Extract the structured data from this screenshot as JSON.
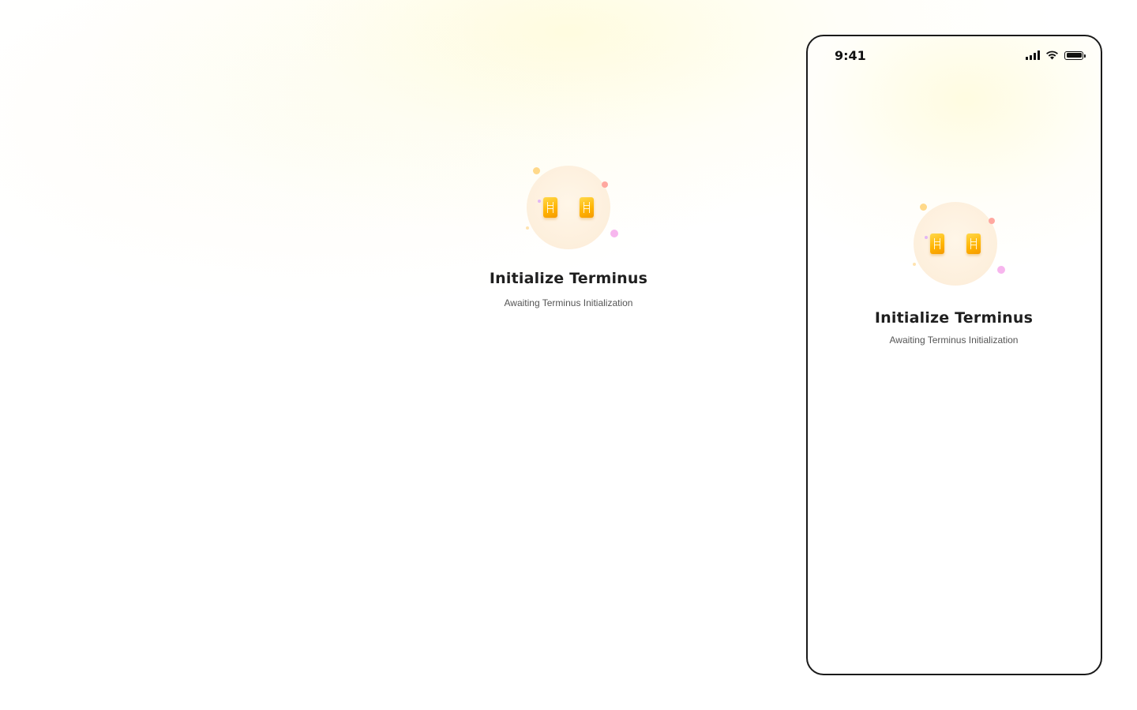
{
  "desktop": {
    "title": "Initialize Terminus",
    "subtitle": "Awaiting Terminus Initialization",
    "illustration_icon": "terminus-cards-icon"
  },
  "mobile": {
    "status_bar": {
      "time": "9:41",
      "icons": [
        "cellular-signal-icon",
        "wifi-icon",
        "battery-icon"
      ]
    },
    "title": "Initialize Terminus",
    "subtitle": "Awaiting Terminus Initialization",
    "illustration_icon": "terminus-cards-icon"
  },
  "colors": {
    "title": "#1f1f1f",
    "subtitle": "#555555",
    "accent_card": "#ffb300",
    "background_glow": "#fffad0",
    "frame_border": "#1a1a1a"
  }
}
